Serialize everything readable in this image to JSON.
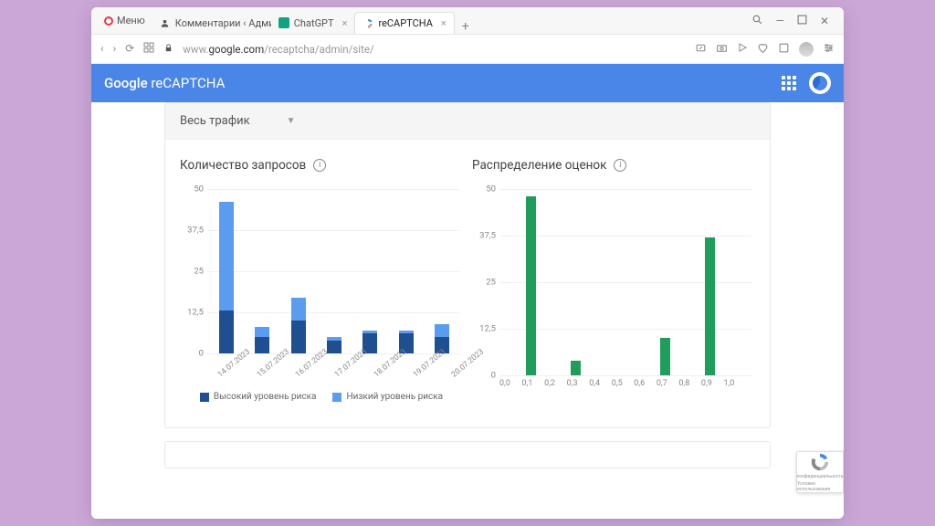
{
  "browser": {
    "menu_label": "Меню",
    "tabs": [
      {
        "title": "Комментарии ‹ Админки…",
        "favicon": "user"
      },
      {
        "title": "ChatGPT",
        "favicon": "chatgpt"
      },
      {
        "title": "reCAPTCHA",
        "favicon": "recaptcha",
        "active": true
      }
    ],
    "url_prefix": "www.",
    "url_domain": "google.com",
    "url_path": "/recaptcha/admin/site/"
  },
  "header": {
    "brand_main": "Google",
    "brand_sub": " reCAPTCHA"
  },
  "filter": {
    "selected": "Весь трафик"
  },
  "chart1": {
    "title": "Количество запросов",
    "legend_high": "Высокий уровень риска",
    "legend_low": "Низкий уровень риска"
  },
  "chart2": {
    "title": "Распределение оценок"
  },
  "recaptcha_badge": {
    "line1": "конфиденциальность",
    "line2": "Условия использования"
  },
  "chart_data": [
    {
      "type": "bar",
      "title": "Количество запросов",
      "stacked": true,
      "categories": [
        "14.07.2023",
        "15.07.2023",
        "16.07.2023",
        "17.07.2023",
        "18.07.2023",
        "19.07.2023",
        "20.07.2023"
      ],
      "series": [
        {
          "name": "Высокий уровень риска",
          "color": "#1d4f91",
          "values": [
            13,
            5,
            10,
            4,
            6,
            6,
            5
          ]
        },
        {
          "name": "Низкий уровень риска",
          "color": "#5a9df0",
          "values": [
            33,
            3,
            7,
            1,
            1,
            1,
            4
          ]
        }
      ],
      "ylim": [
        0,
        50
      ],
      "yticks": [
        0,
        12.5,
        25,
        37.5,
        50
      ],
      "ytick_labels": [
        "0",
        "12,5",
        "25",
        "37,5",
        "50"
      ]
    },
    {
      "type": "bar",
      "title": "Распределение оценок",
      "categories": [
        "0,0",
        "0,1",
        "0,2",
        "0,3",
        "0,4",
        "0,5",
        "0,6",
        "0,7",
        "0,8",
        "0,9",
        "1,0"
      ],
      "values": [
        0,
        48,
        0,
        4,
        0,
        0,
        0,
        10,
        0,
        37,
        0
      ],
      "color": "#1e9e5a",
      "ylim": [
        0,
        50
      ],
      "yticks": [
        0,
        12.5,
        25,
        37.5,
        50
      ],
      "ytick_labels": [
        "0",
        "12,5",
        "25",
        "37,5",
        "50"
      ]
    }
  ]
}
